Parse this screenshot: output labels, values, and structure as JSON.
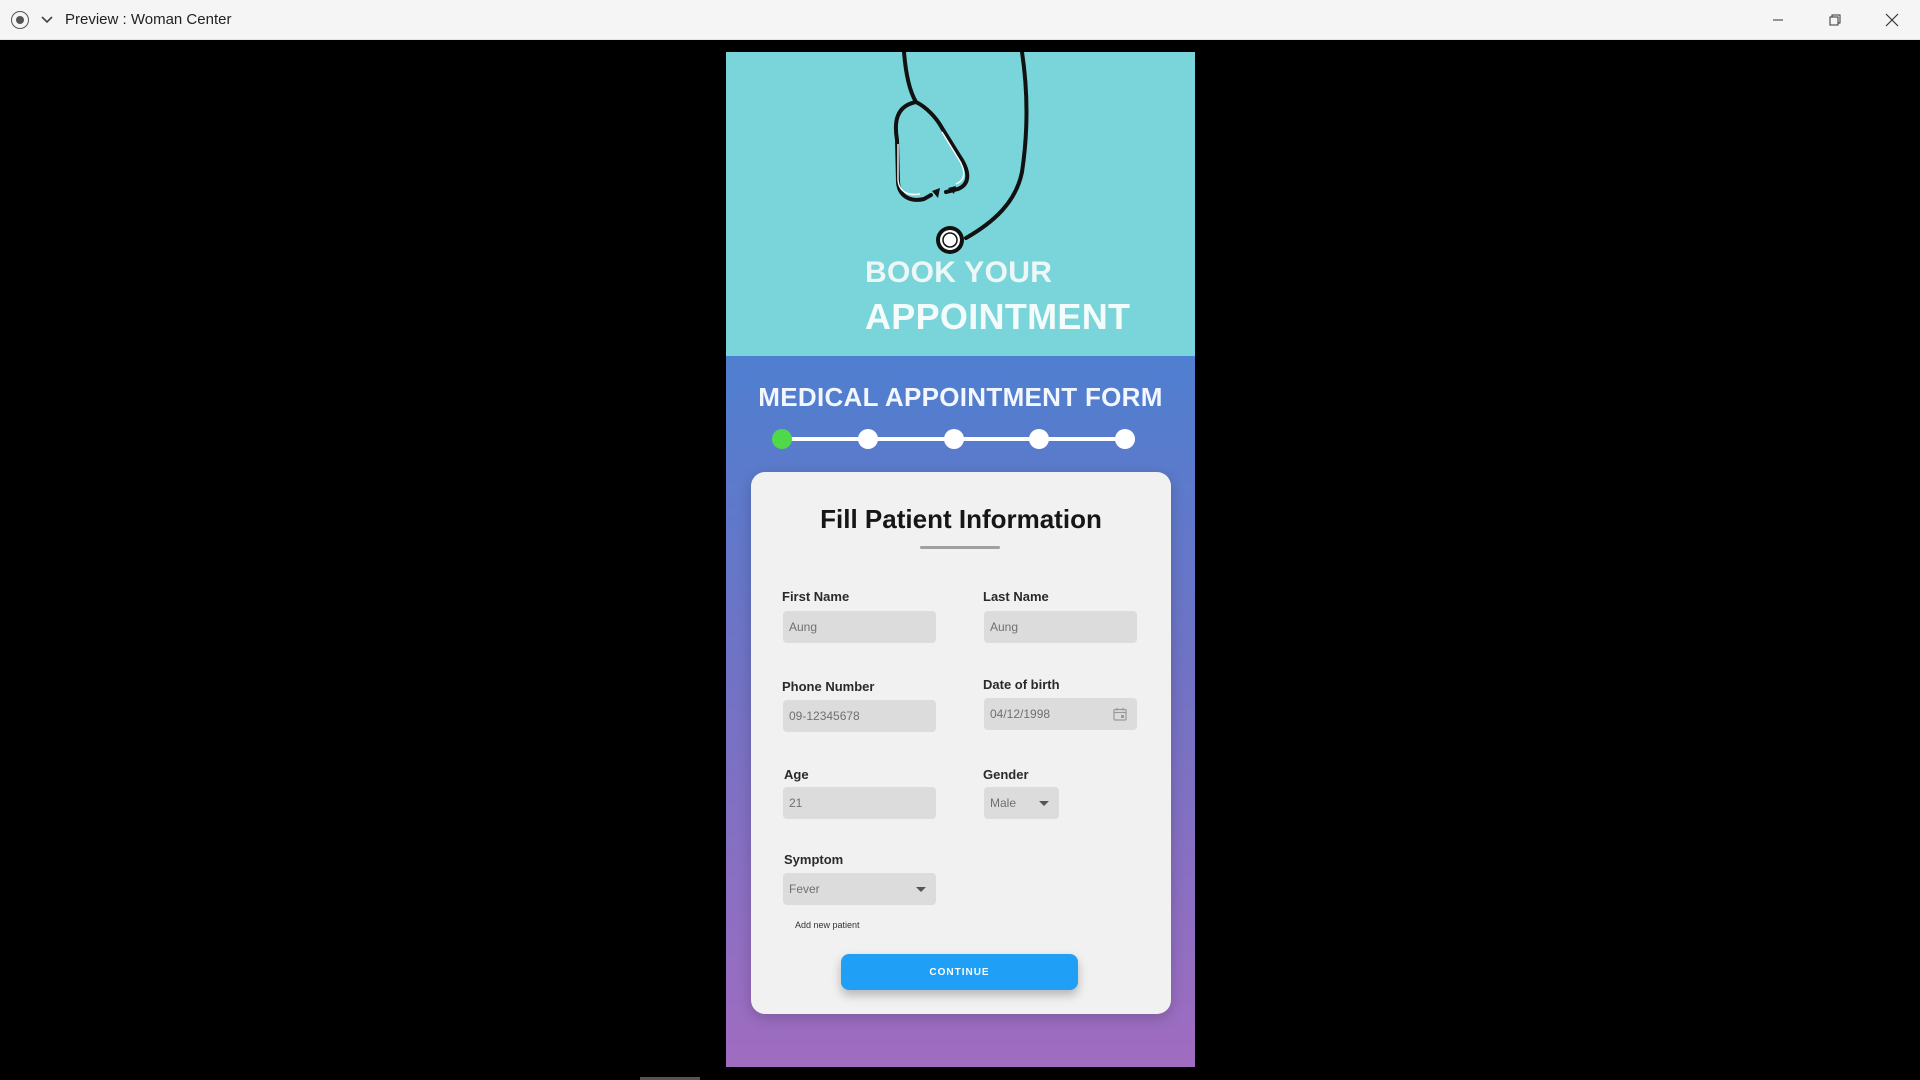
{
  "window": {
    "title": "Preview : Woman Center"
  },
  "hero": {
    "line1": "BOOK YOUR",
    "line2": "APPOINTMENT"
  },
  "form": {
    "title": "MEDICAL APPOINTMENT FORM",
    "steps_total": 5,
    "current_step": 1
  },
  "card": {
    "title": "Fill Patient Information",
    "fields": {
      "first_name": {
        "label": "First Name",
        "value": "Aung"
      },
      "last_name": {
        "label": "Last Name",
        "value": "Aung"
      },
      "phone": {
        "label": "Phone Number",
        "value": "09-12345678"
      },
      "dob": {
        "label": "Date of birth",
        "value": "04/12/1998"
      },
      "age": {
        "label": "Age",
        "value": "21"
      },
      "gender": {
        "label": "Gender",
        "value": "Male"
      },
      "symptom": {
        "label": "Symptom",
        "value": "Fever"
      }
    },
    "add_link": "Add new patient",
    "continue_label": "CONTINUE"
  },
  "colors": {
    "hero_bg": "#7ad5da",
    "active_step": "#4fd84a",
    "continue_button": "#1f9ff5"
  }
}
